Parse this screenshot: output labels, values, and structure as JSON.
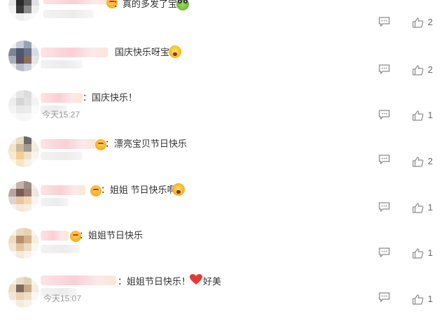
{
  "colors": {
    "background": "#ffffff",
    "text": "#333333",
    "timestamp": "#999999",
    "icon": "#8a8a8a",
    "heart": "#e53935"
  },
  "icons": {
    "comment": "comment-icon",
    "like": "thumbs-up-icon"
  },
  "comments": [
    {
      "text": "：真的多发了宝",
      "time": "",
      "likes": "2"
    },
    {
      "text": "国庆快乐呀宝",
      "time": "",
      "likes": "2"
    },
    {
      "text": "：国庆快乐！",
      "time": "今天15:27",
      "likes": "1"
    },
    {
      "text": "：漂亮宝贝节日快乐",
      "time": "",
      "likes": "2"
    },
    {
      "text": "：姐姐 节日快乐啊",
      "time": "",
      "likes": "1"
    },
    {
      "text": "：姐姐节日快乐",
      "time": "",
      "likes": "1"
    },
    {
      "text": "：姐姐节日快乐！",
      "text_after": "好美",
      "time": "今天15:07",
      "likes": "1"
    }
  ]
}
